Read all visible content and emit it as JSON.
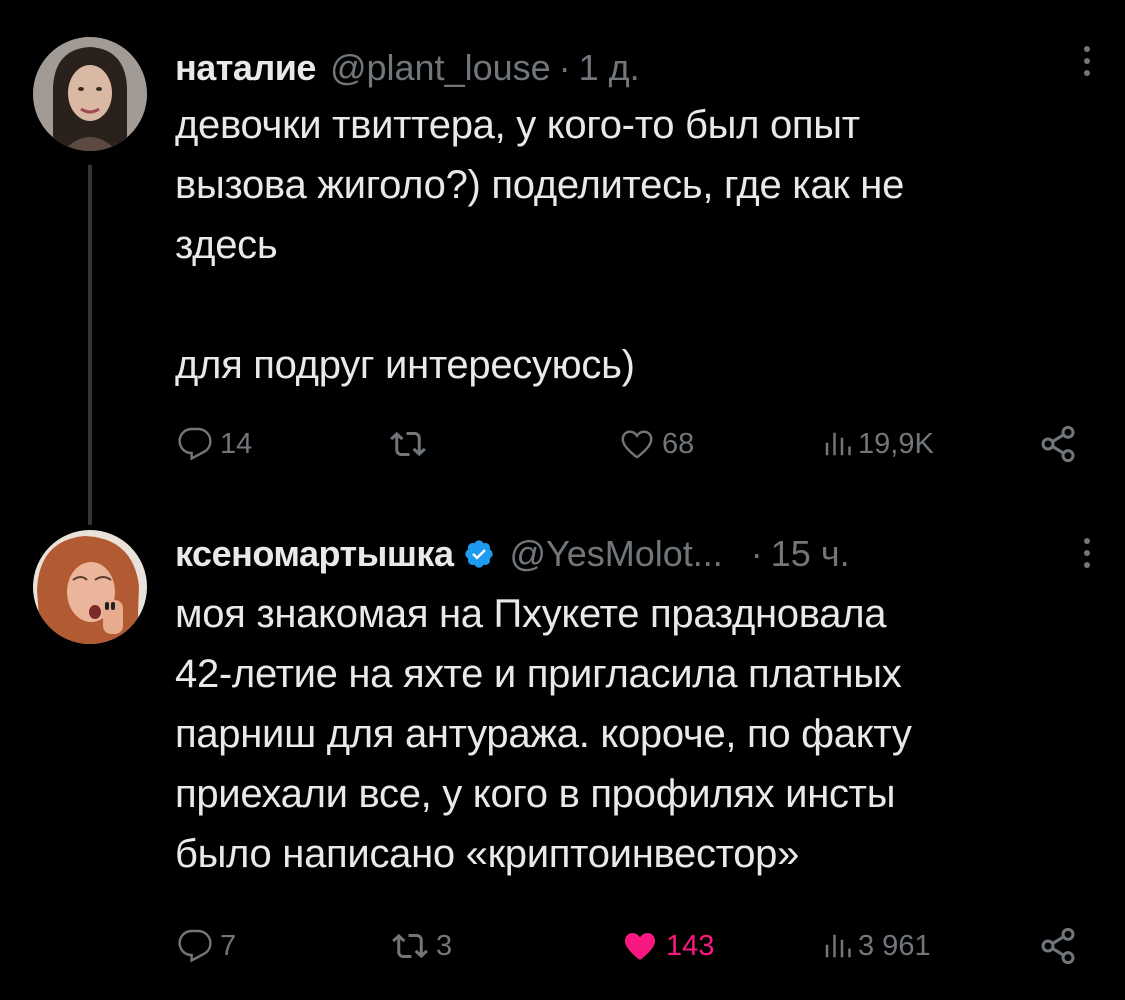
{
  "tweets": [
    {
      "name": "наталие",
      "handle": "@plant_louse",
      "dot": "·",
      "time": "1 д.",
      "text": "девочки твиттера, у кого-то был опыт\nвызова жиголо?) поделитесь, где как не\nздесь\n\nдля подруг интересуюсь)",
      "actions": {
        "replies": "14",
        "retweets": "",
        "likes": "68",
        "views": "19,9K"
      },
      "icons": [
        "reply-icon",
        "retweet-icon",
        "like-icon",
        "views-icon",
        "share-icon"
      ]
    },
    {
      "name": "ксеномартышка",
      "verified": true,
      "handle": "@YesMolot...",
      "dot": "·",
      "time": "15 ч.",
      "text": "моя знакомая на Пхукете праздновала\n42-летие на яхте и пригласила платных\nпарниш для антуража. короче, по факту\nприехали все, у кого в профилях инсты\nбыло написано «криптоинвестор»",
      "actions": {
        "replies": "7",
        "retweets": "3",
        "likes": "143",
        "views": "3 961"
      },
      "liked": true,
      "icons": [
        "reply-icon",
        "retweet-icon",
        "heart-filled-icon",
        "views-icon",
        "share-icon"
      ]
    }
  ],
  "colors": {
    "background": "#000000",
    "text": "#e7e9ea",
    "muted": "#71767b",
    "like": "#f91880",
    "verified": "#1d9bf0"
  }
}
